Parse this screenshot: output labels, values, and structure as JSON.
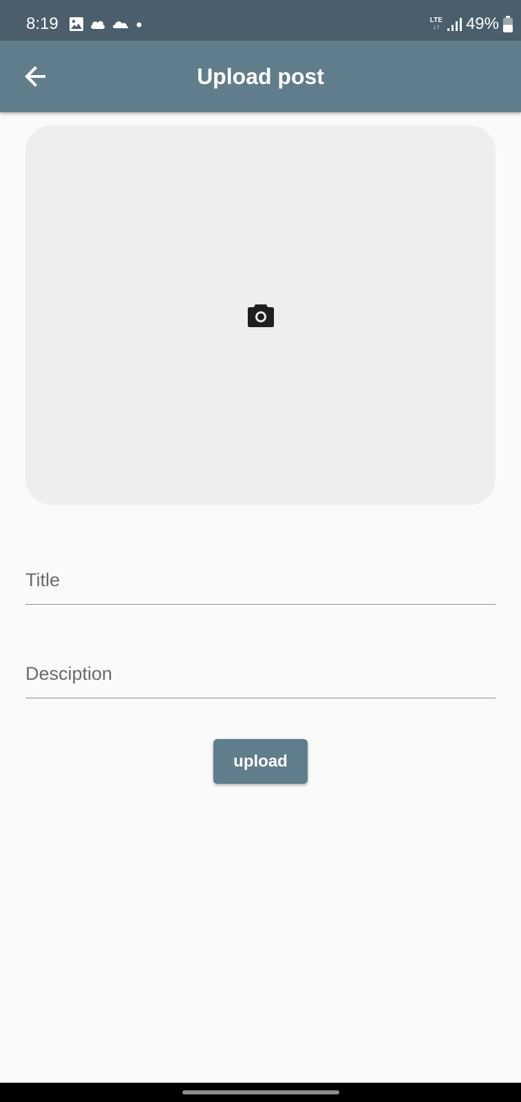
{
  "status_bar": {
    "time": "8:19",
    "network": "LTE",
    "battery": "49%",
    "icons_left": [
      "image-icon",
      "cloud-icon",
      "cloud-icon",
      "dot-icon"
    ],
    "icons_right": [
      "lte-icon",
      "signal-icon",
      "battery-icon"
    ]
  },
  "app_bar": {
    "title": "Upload post",
    "back_icon": "arrow-back-icon",
    "color": "#607d8b"
  },
  "image_picker": {
    "icon": "camera-icon",
    "background": "#eeeeee"
  },
  "form": {
    "title_placeholder": "Title",
    "title_value": "",
    "description_placeholder": "Desciption",
    "description_value": "",
    "upload_label": "upload"
  },
  "colors": {
    "status_bar": "#4a5f6b",
    "primary": "#607d8b",
    "background": "#fafafa"
  }
}
